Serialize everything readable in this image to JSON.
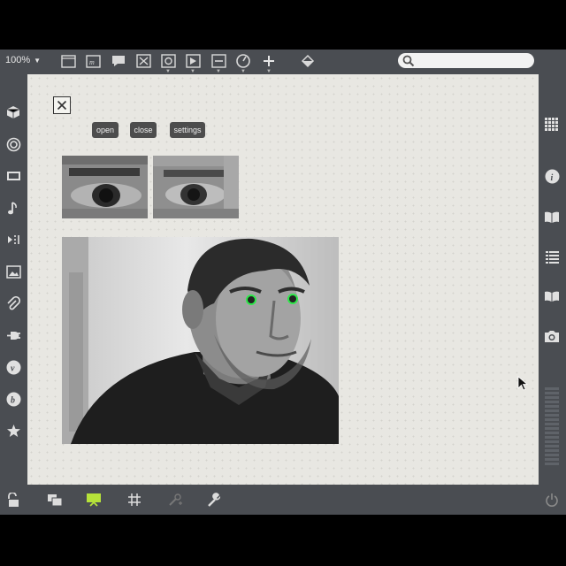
{
  "toolbar": {
    "zoom": "100%",
    "zoom_arrow": "▼",
    "icons": [
      "presentation-icon",
      "message-box-icon",
      "comment-icon",
      "toggle-icon",
      "button-icon",
      "playbutton-icon",
      "slider-icon",
      "dial-icon",
      "plus-icon",
      "paint-bucket-icon"
    ]
  },
  "search": {
    "placeholder": ""
  },
  "patcher": {
    "buttons": {
      "open": "open",
      "close": "close",
      "settings": "settings"
    }
  },
  "left_sidebar": [
    "cube-icon",
    "target-icon",
    "media-icon",
    "music-note-icon",
    "playlist-icon",
    "image-icon",
    "paperclip-icon",
    "plug-icon",
    "vizzie-icon",
    "beap-icon",
    "star-icon"
  ],
  "right_sidebar": [
    "grid-icon",
    "info-icon",
    "book-icon",
    "list-icon",
    "reference-icon",
    "camera-icon"
  ],
  "bottom_bar": [
    "lock-icon",
    "windows-icon",
    "presentation-mode-icon",
    "grid-icon",
    "tools-icon",
    "wrench-icon",
    "power-icon"
  ],
  "colors": {
    "chrome": "#4a4d52",
    "canvas": "#e8e7e2",
    "eye_marker": "#2ee84a",
    "presentation_active": "#b6e23a"
  }
}
